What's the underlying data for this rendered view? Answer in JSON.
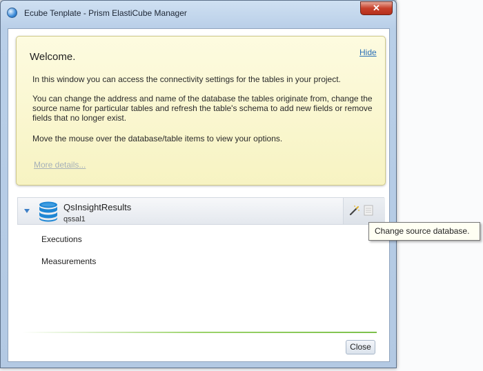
{
  "window": {
    "title": "Ecube Tenplate - Prism ElastiCube Manager",
    "close_glyph": "✕"
  },
  "welcome": {
    "title": "Welcome.",
    "hide_label": "Hide",
    "paragraphs": [
      "In this window you can access the connectivity settings for the tables in your project.",
      "You can change the address and name of the database the tables originate from, change the source name for particular tables and refresh the table's schema to add new fields or remove fields that no longer exist.",
      "Move the mouse over the database/table items to view your options."
    ],
    "more_details_label": "More details..."
  },
  "database": {
    "name": "QsInsightResults",
    "server": "qssal1",
    "tables": [
      "Executions",
      "Measurements"
    ],
    "icons": [
      "database-icon",
      "wand-icon",
      "refresh-schema-icon"
    ]
  },
  "tooltip": {
    "text": "Change source database."
  },
  "footer": {
    "close_label": "Close"
  },
  "colors": {
    "welcome_bg": "#f7f3c2",
    "link": "#2a6fb7",
    "db_icon": "#1e86d4",
    "accent_line": "#9bd36a"
  }
}
